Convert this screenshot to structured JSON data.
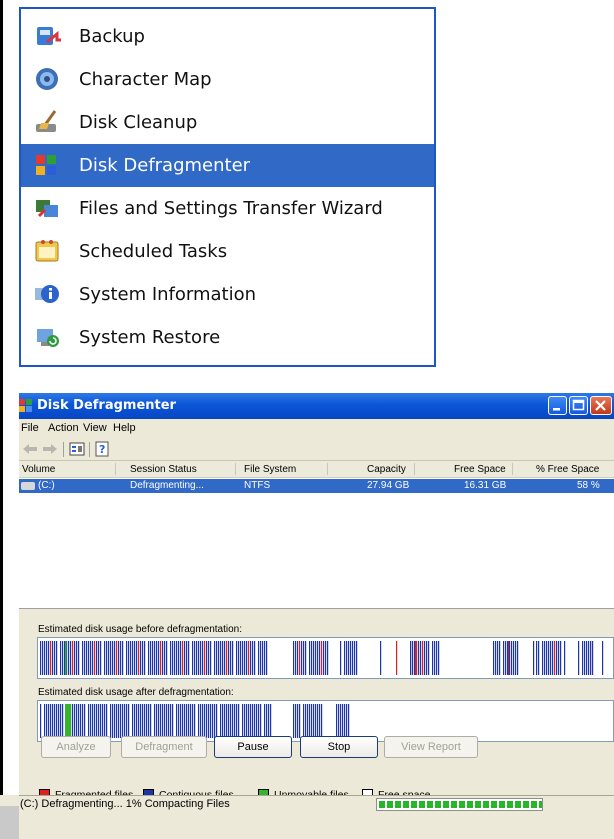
{
  "start_menu": {
    "items": [
      {
        "label": "Backup",
        "icon": "backup-icon",
        "selected": false
      },
      {
        "label": "Character Map",
        "icon": "character-map-icon",
        "selected": false
      },
      {
        "label": "Disk Cleanup",
        "icon": "disk-cleanup-icon",
        "selected": false
      },
      {
        "label": "Disk Defragmenter",
        "icon": "disk-defragmenter-icon",
        "selected": true
      },
      {
        "label": "Files and Settings Transfer Wizard",
        "icon": "transfer-wizard-icon",
        "selected": false
      },
      {
        "label": "Scheduled Tasks",
        "icon": "scheduled-tasks-icon",
        "selected": false
      },
      {
        "label": "System Information",
        "icon": "system-information-icon",
        "selected": false
      },
      {
        "label": "System Restore",
        "icon": "system-restore-icon",
        "selected": false
      }
    ]
  },
  "window": {
    "title": "Disk Defragmenter",
    "menus": [
      "File",
      "Action",
      "View",
      "Help"
    ],
    "toolbar": [
      "back-icon",
      "forward-icon",
      "properties-icon",
      "help-icon"
    ],
    "columns": [
      "Volume",
      "Session Status",
      "File System",
      "Capacity",
      "Free Space",
      "% Free Space"
    ],
    "volumes": [
      {
        "volume": "(C:)",
        "status": "Defragmenting...",
        "file_system": "NTFS",
        "capacity": "27.94 GB",
        "free_space": "16.31 GB",
        "free_pct": "58 %"
      }
    ],
    "before_label": "Estimated disk usage before defragmentation:",
    "after_label": "Estimated disk usage after defragmentation:",
    "buttons": [
      {
        "label": "Analyze",
        "enabled": false
      },
      {
        "label": "Defragment",
        "enabled": false
      },
      {
        "label": "Pause",
        "enabled": true
      },
      {
        "label": "Stop",
        "enabled": true
      },
      {
        "label": "View Report",
        "enabled": false
      }
    ],
    "legend": [
      {
        "label": "Fragmented files",
        "color": "#e02020"
      },
      {
        "label": "Contiguous files",
        "color": "#1c35a8"
      },
      {
        "label": "Unmovable files",
        "color": "#35b52a"
      },
      {
        "label": "Free space",
        "color": "#ffffff"
      }
    ],
    "status_text": "(C:) Defragmenting... 1% Compacting Files",
    "progress_percent": 1
  },
  "colors": {
    "selection": "#3169c6",
    "titlebar": "#0a56d8",
    "fragmented": "#e02020",
    "contiguous": "#1c35a8",
    "unmovable": "#35b52a"
  }
}
